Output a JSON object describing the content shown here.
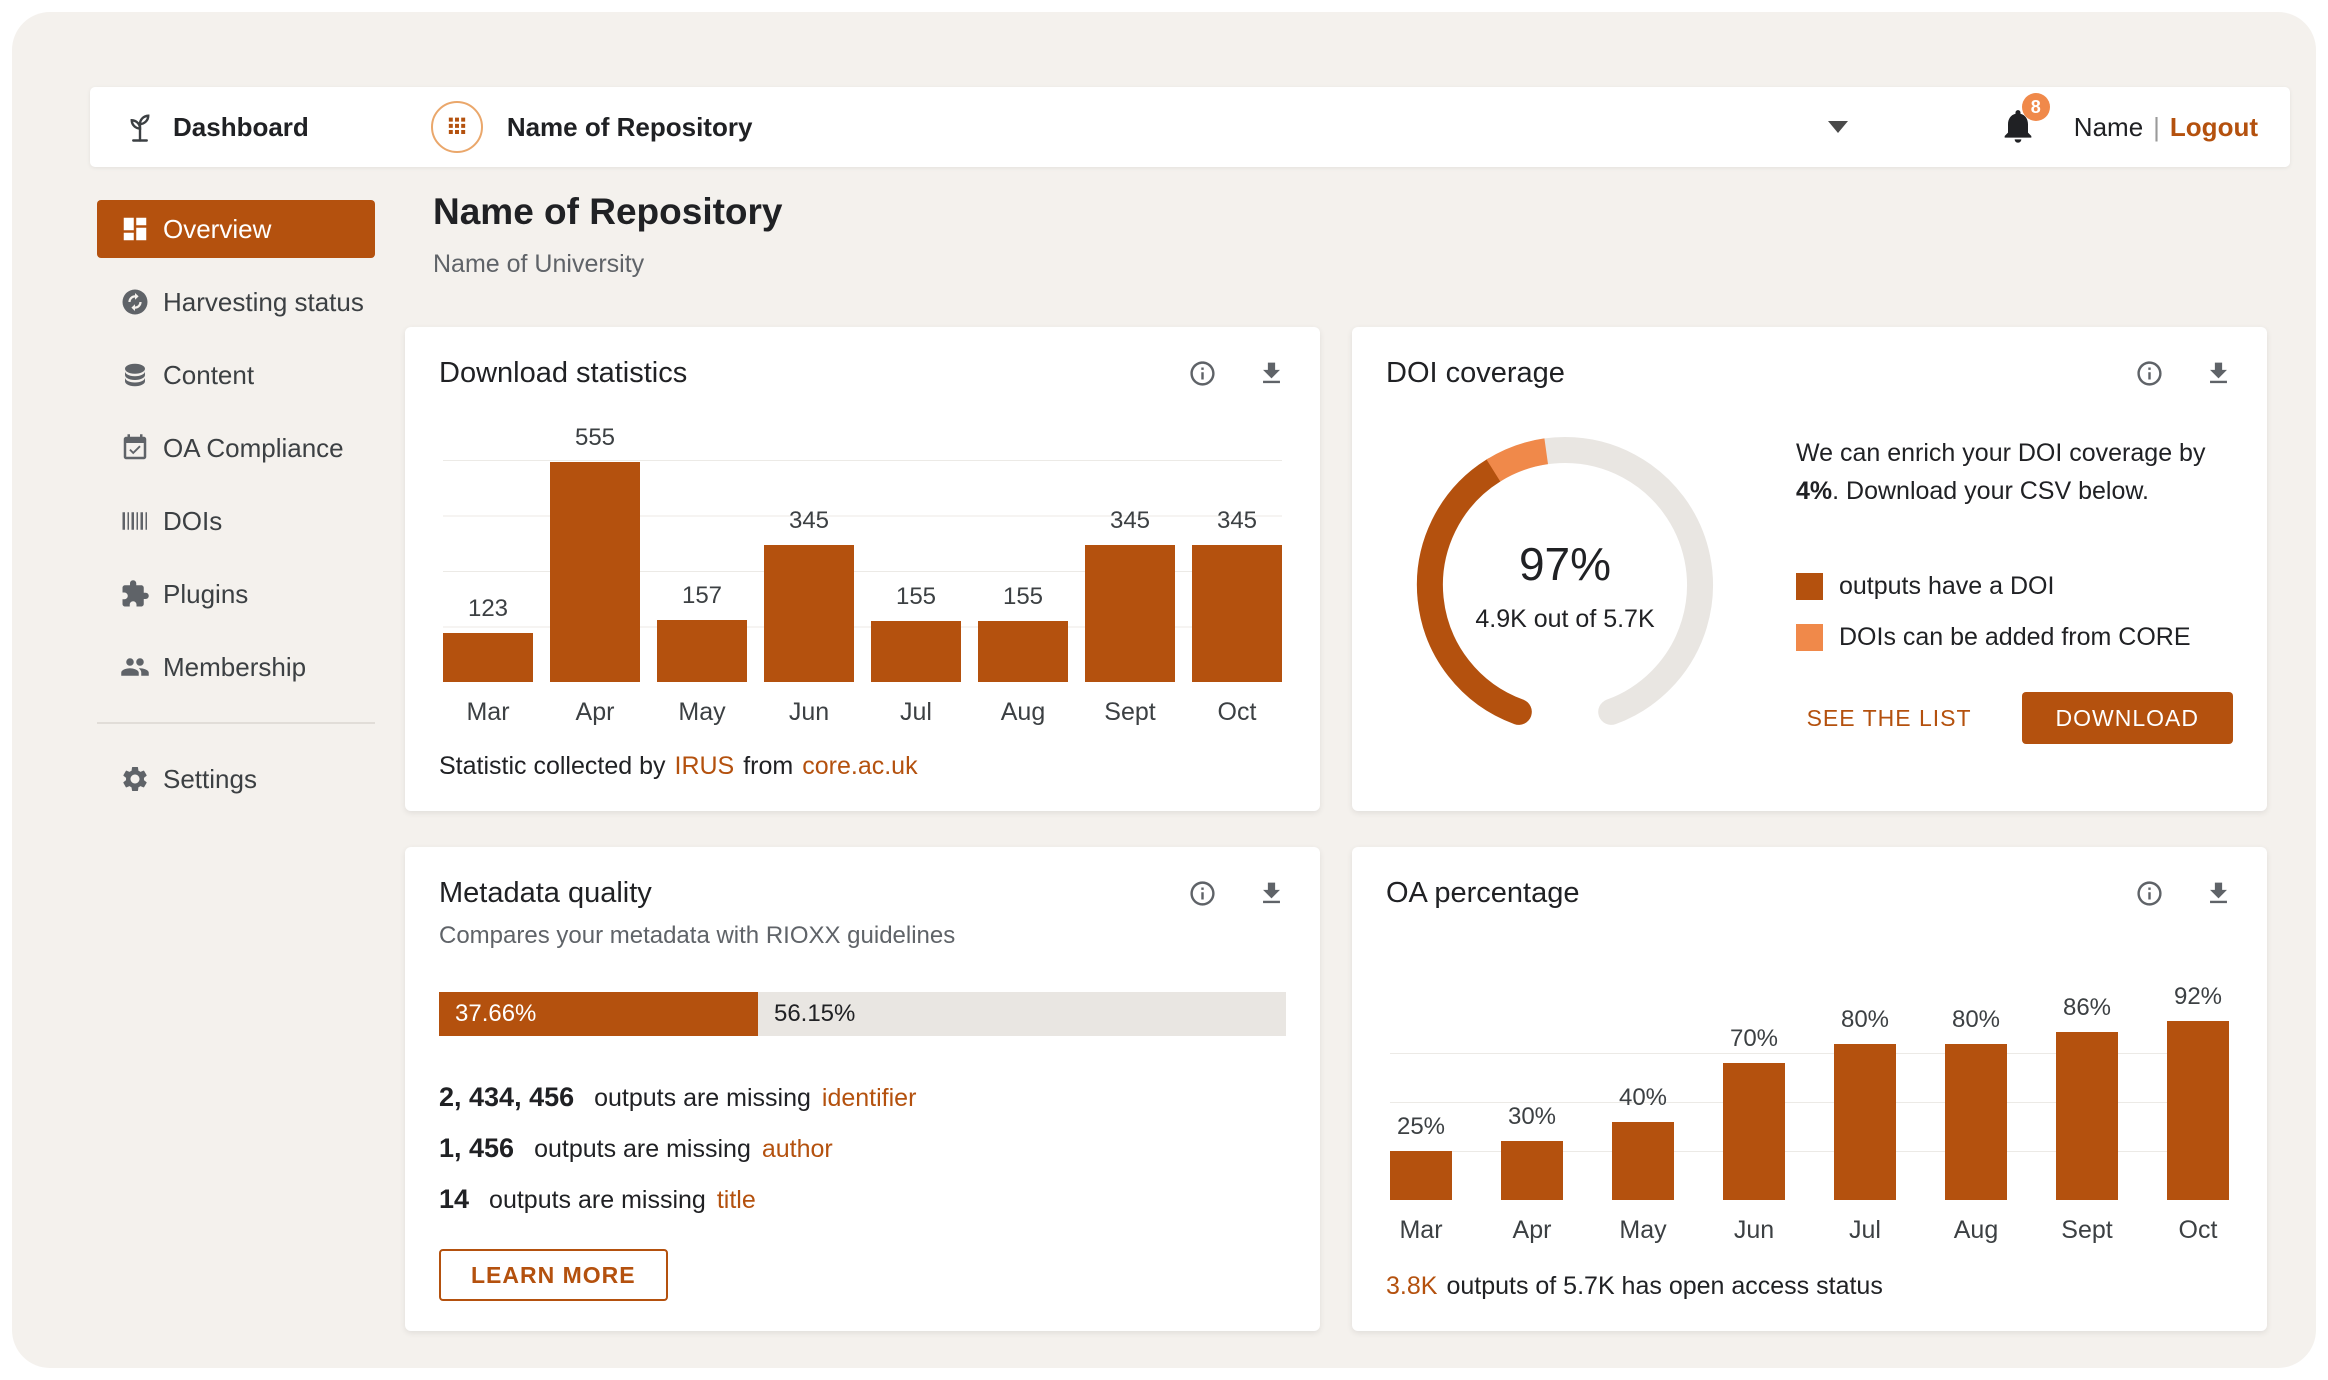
{
  "topbar": {
    "brand": "Dashboard",
    "repo_selector": "Name of Repository",
    "notifications_count": "8",
    "user_name": "Name",
    "divider": "|",
    "logout": "Logout"
  },
  "sidebar": {
    "items": [
      {
        "label": "Overview",
        "icon": "dashboard-icon",
        "active": true
      },
      {
        "label": "Harvesting status",
        "icon": "sync-circle-icon",
        "active": false
      },
      {
        "label": "Content",
        "icon": "database-icon",
        "active": false
      },
      {
        "label": "OA Compliance",
        "icon": "calendar-check-icon",
        "active": false
      },
      {
        "label": "DOIs",
        "icon": "barcode-icon",
        "active": false
      },
      {
        "label": "Plugins",
        "icon": "puzzle-icon",
        "active": false
      },
      {
        "label": "Membership",
        "icon": "people-icon",
        "active": false
      }
    ],
    "footer_items": [
      {
        "label": "Settings",
        "icon": "gear-icon"
      }
    ]
  },
  "page": {
    "title": "Name of Repository",
    "subtitle": "Name of University"
  },
  "cards": {
    "downloads": {
      "title": "Download statistics",
      "footer": {
        "prefix": "Statistic collected by",
        "link1": "IRUS",
        "middle": "from",
        "link2": "core.ac.uk"
      }
    },
    "doi": {
      "title": "DOI coverage",
      "percent": "97%",
      "fraction": "4.9K out of 5.7K",
      "blurb_before": "We can enrich your DOI coverage by",
      "blurb_bold": "4%",
      "blurb_after": ". Download your CSV below.",
      "legend": [
        {
          "label": "outputs have a DOI",
          "color": "#b4510e"
        },
        {
          "label": "DOIs can be added from CORE",
          "color": "#f0894a"
        }
      ],
      "see_list_label": "SEE THE LIST",
      "download_label": "DOWNLOAD"
    },
    "metadata": {
      "title": "Metadata quality",
      "subtitle": "Compares your metadata with RIOXX guidelines",
      "bar": {
        "filled_label": "37.66%",
        "filled_percent": 37.66,
        "rest_label": "56.15%"
      },
      "missing": [
        {
          "count": "2, 434, 456",
          "text": "outputs are missing",
          "field": "identifier"
        },
        {
          "count": "1, 456",
          "text": "outputs are missing",
          "field": "author"
        },
        {
          "count": "14",
          "text": "outputs are missing",
          "field": "title"
        }
      ],
      "learn_more_label": "LEARN MORE"
    },
    "oa": {
      "title": "OA percentage",
      "footer_highlight": "3.8K",
      "footer_rest": "outputs of 5.7K has open access status"
    }
  },
  "colors": {
    "accent": "#b4510e",
    "accent_light": "#f0894a",
    "background": "#f4f1ed"
  },
  "chart_data": [
    {
      "id": "downloads",
      "type": "bar",
      "title": "Download statistics",
      "categories": [
        "Mar",
        "Apr",
        "May",
        "Jun",
        "Jul",
        "Aug",
        "Sept",
        "Oct"
      ],
      "values": [
        123,
        555,
        157,
        345,
        155,
        155,
        345,
        345
      ],
      "ylim": [
        0,
        560
      ],
      "bar_color": "#b4510e",
      "grid": true,
      "value_suffix": ""
    },
    {
      "id": "oa",
      "type": "bar",
      "title": "OA percentage",
      "categories": [
        "Mar",
        "Apr",
        "May",
        "Jun",
        "Jul",
        "Aug",
        "Sept",
        "Oct"
      ],
      "values": [
        25,
        30,
        40,
        70,
        80,
        80,
        86,
        92
      ],
      "ylim": [
        0,
        100
      ],
      "bar_color": "#b4510e",
      "grid": true,
      "value_suffix": "%"
    },
    {
      "id": "doi_gauge",
      "type": "donut",
      "title": "DOI coverage",
      "percent": 97,
      "center_label": "4.9K out of 5.7K",
      "segments": [
        {
          "label": "outputs have a DOI",
          "color": "#b4510e"
        },
        {
          "label": "DOIs can be added from CORE",
          "color": "#f0894a"
        }
      ]
    }
  ]
}
